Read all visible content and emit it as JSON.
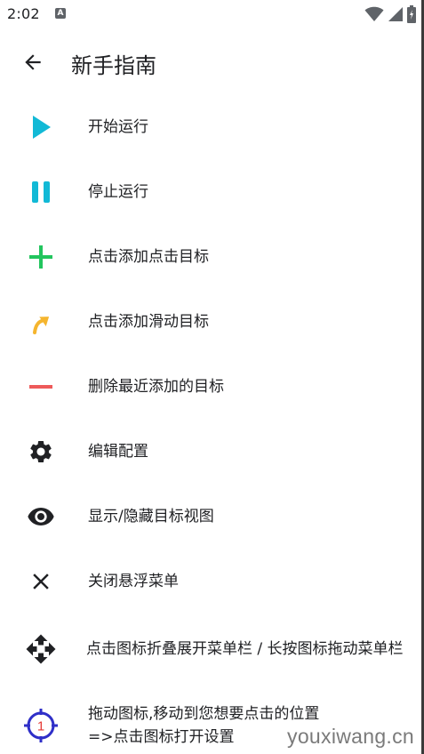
{
  "status_bar": {
    "time": "2:02",
    "notification_glyph": "A",
    "icons": [
      "wifi-icon",
      "cell-signal-icon",
      "battery-charging-icon"
    ]
  },
  "app_bar": {
    "back_icon": "arrow-back-icon",
    "title": "新手指南"
  },
  "colors": {
    "play": "#12b9d6",
    "pause": "#12b9d6",
    "add": "#22c55e",
    "swipe": "#f5b52e",
    "remove": "#ee5a5a",
    "dark_icon": "#202124",
    "target_ring": "#2f2fc8",
    "target_number": "#e53935"
  },
  "items": [
    {
      "icon": "play-icon",
      "label": "开始运行"
    },
    {
      "icon": "pause-icon",
      "label": "停止运行"
    },
    {
      "icon": "plus-icon",
      "label": "点击添加点击目标"
    },
    {
      "icon": "curved-arrow-icon",
      "label": "点击添加滑动目标"
    },
    {
      "icon": "minus-icon",
      "label": "删除最近添加的目标"
    },
    {
      "icon": "gear-icon",
      "label": "编辑配置"
    },
    {
      "icon": "eye-icon",
      "label": "显示/隐藏目标视图"
    },
    {
      "icon": "close-icon",
      "label": "关闭悬浮菜单"
    },
    {
      "icon": "move-icon",
      "label": "点击图标折叠展开菜单栏 / 长按图标拖动菜单栏"
    },
    {
      "icon": "crosshair-target-icon",
      "label": "拖动图标,移动到您想要点击的位置=>点击图标打开设置",
      "label_line1": "拖动图标,移动到您想要点击的位置",
      "label_line2": "=>点击图标打开设置",
      "target_number": "1"
    }
  ],
  "watermark": "youxiwang.cn"
}
